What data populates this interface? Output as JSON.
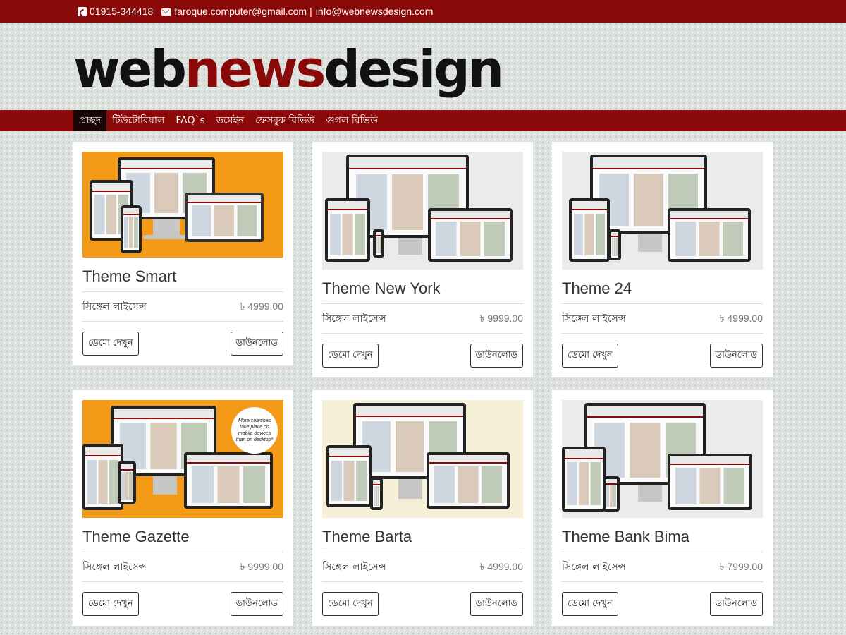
{
  "topbar": {
    "phone": "01915-344418",
    "email1": "faroque.computer@gmail.com",
    "separator": "|",
    "email2": "info@webnewsdesign.com"
  },
  "logo": {
    "part1": "web",
    "part2": "news",
    "part3": "design"
  },
  "nav": {
    "items": [
      "প্রচ্ছদ",
      "টিউটোরিয়াল",
      "FAQ`s",
      "ডমেইন",
      "ফেসবুক রিভিউ",
      "গুগল রিভিউ"
    ],
    "active_index": 0
  },
  "cards": [
    {
      "title": "Theme Smart",
      "license": "সিঙ্গেল লাইসেন্স",
      "price": "৳ 4999.00",
      "demo_label": "ডেমো দেখুন",
      "download_label": "ডাউনলোড"
    },
    {
      "title": "Theme New York",
      "license": "সিঙ্গেল লাইসেন্স",
      "price": "৳ 9999.00",
      "demo_label": "ডেমো দেখুন",
      "download_label": "ডাউনলোড"
    },
    {
      "title": "Theme 24",
      "license": "সিঙ্গেল লাইসেন্স",
      "price": "৳ 4999.00",
      "demo_label": "ডেমো দেখুন",
      "download_label": "ডাউনলোড"
    },
    {
      "title": "Theme Gazette",
      "license": "সিঙ্গেল লাইসেন্স",
      "price": "৳ 9999.00",
      "demo_label": "ডেমো দেখুন",
      "download_label": "ডাউনলোড",
      "bubble_text": "More searches take place on mobile devices than on desktop*"
    },
    {
      "title": "Theme Barta",
      "license": "সিঙ্গেল লাইসেন্স",
      "price": "৳ 4999.00",
      "demo_label": "ডেমো দেখুন",
      "download_label": "ডাউনলোড"
    },
    {
      "title": "Theme Bank Bima",
      "license": "সিঙ্গেল লাইসেন্স",
      "price": "৳ 7999.00",
      "demo_label": "ডেমো দেখুন",
      "download_label": "ডাউনলোড"
    }
  ],
  "colors": {
    "brand": "#8a0a0a",
    "nav_active": "#1a0505",
    "orange_bg": "#f39a17"
  }
}
